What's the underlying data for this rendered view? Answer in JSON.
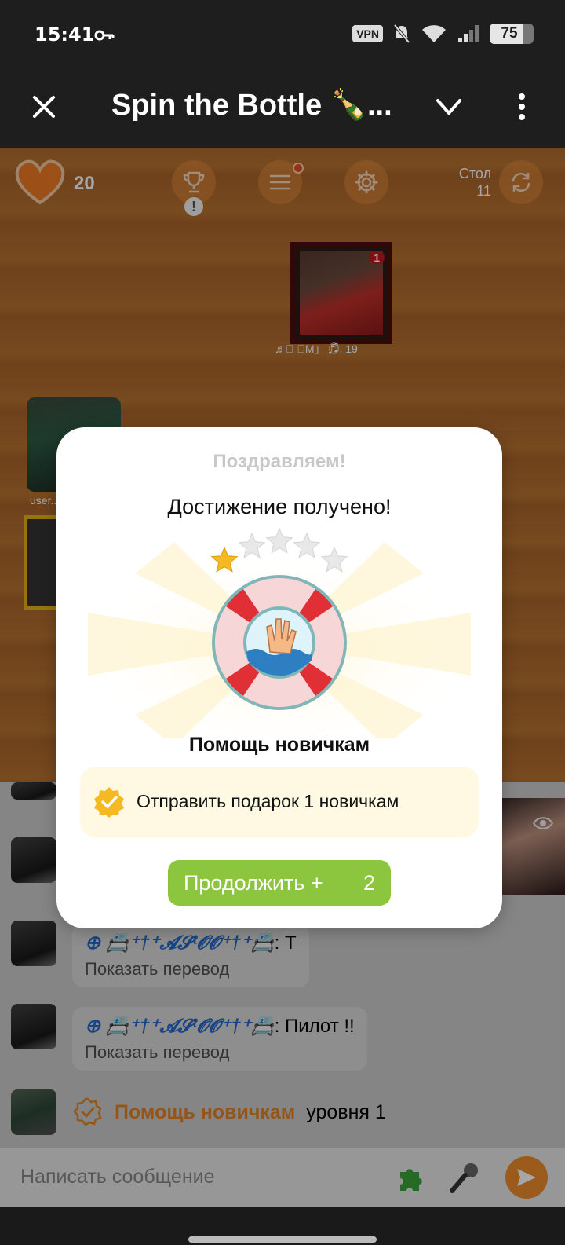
{
  "status_bar": {
    "time": "15:41",
    "vpn": "VPN",
    "battery": "75",
    "battery_level": 0.75
  },
  "app_bar": {
    "title": "Spin the Bottle 🍾..."
  },
  "game": {
    "hearts": "20",
    "table_label": "Стол",
    "table_number": "11",
    "warn_symbol": "!",
    "player_top": {
      "kisses": "1",
      "name": "♬⃝ 「M」 ♬⃝, 19"
    },
    "player_left": {
      "name": "user..."
    }
  },
  "chat": {
    "messages": [
      {
        "author": "⊕ 📇⁺†⁺𝓐𝓢ᵗ𝓞𝓞⁺†⁺📇",
        "text": ": Т",
        "translate": "Показать перевод"
      },
      {
        "author": "⊕ 📇⁺†⁺𝓐𝓢ᵗ𝓞𝓞⁺†⁺📇",
        "text": ": Пилот !!",
        "translate": "Показать перевод"
      }
    ],
    "system": {
      "title": "Помощь новичкам",
      "text": "уровня 1"
    },
    "input_placeholder": "Написать сообщение"
  },
  "dialog": {
    "congrats": "Поздравляем!",
    "achieved": "Достижение получено!",
    "badge_title": "Помощь новичкам",
    "stars_earned": 1,
    "stars_total": 5,
    "task": "Отправить подарок 1 новичкам",
    "continue_label": "Продолжить +",
    "reward": "2"
  },
  "colors": {
    "accent_orange": "#ef8d2c",
    "button_green": "#8cc63f",
    "task_bg": "#fff9e3",
    "topbar": "#1e1e1e"
  }
}
